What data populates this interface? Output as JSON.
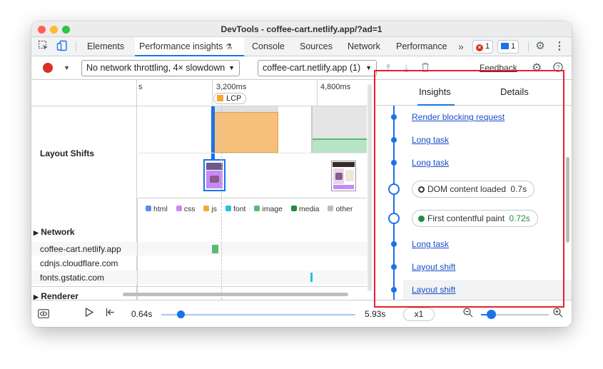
{
  "window": {
    "title": "DevTools - coffee-cart.netlify.app/?ad=1"
  },
  "tabs": [
    {
      "label": "Elements"
    },
    {
      "label": "Performance insights"
    },
    {
      "label": "Console"
    },
    {
      "label": "Sources"
    },
    {
      "label": "Network"
    },
    {
      "label": "Performance"
    }
  ],
  "tab_extras": {
    "insights_badge": "⚗",
    "close": "×",
    "more": "»"
  },
  "badges": {
    "errors": "1",
    "messages": "1"
  },
  "toolbar": {
    "throttling": "No network throttling, 4× slowdown",
    "page": "coffee-cart.netlify.app (1)",
    "feedback": "Feedback"
  },
  "ruler": {
    "ticks": [
      "s",
      "3,200ms",
      "4,800ms"
    ],
    "lcp_label": "LCP"
  },
  "tracks": {
    "layout_shifts": "Layout Shifts",
    "network": "Network",
    "renderer": "Renderer"
  },
  "network_legend": [
    {
      "label": "html",
      "color": "#5b8def"
    },
    {
      "label": "css",
      "color": "#c58af9"
    },
    {
      "label": "js",
      "color": "#f3a933"
    },
    {
      "label": "font",
      "color": "#24c1e0"
    },
    {
      "label": "image",
      "color": "#5bb974"
    },
    {
      "label": "media",
      "color": "#1e8e3e"
    },
    {
      "label": "other",
      "color": "#bdbdbd"
    }
  ],
  "network_rows": [
    {
      "host": "coffee-cart.netlify.app"
    },
    {
      "host": "cdnjs.cloudflare.com"
    },
    {
      "host": "fonts.gstatic.com"
    }
  ],
  "insights_panel": {
    "tab_insights": "Insights",
    "tab_details": "Details",
    "items": [
      {
        "label": "Render blocking request"
      },
      {
        "label": "Long task"
      },
      {
        "label": "Long task"
      },
      {
        "label": "DOM content loaded",
        "time": "0.7s"
      },
      {
        "label": "First contentful paint",
        "time": "0.72s"
      },
      {
        "label": "Long task"
      },
      {
        "label": "Layout shift"
      },
      {
        "label": "Layout shift"
      }
    ]
  },
  "playback": {
    "start": "0.64s",
    "end": "5.93s",
    "speed": "x1",
    "slider_fraction": 0.1
  },
  "colors": {
    "accent": "#1a73e8",
    "highlight_box": "#e8202a",
    "record": "#d93025"
  }
}
